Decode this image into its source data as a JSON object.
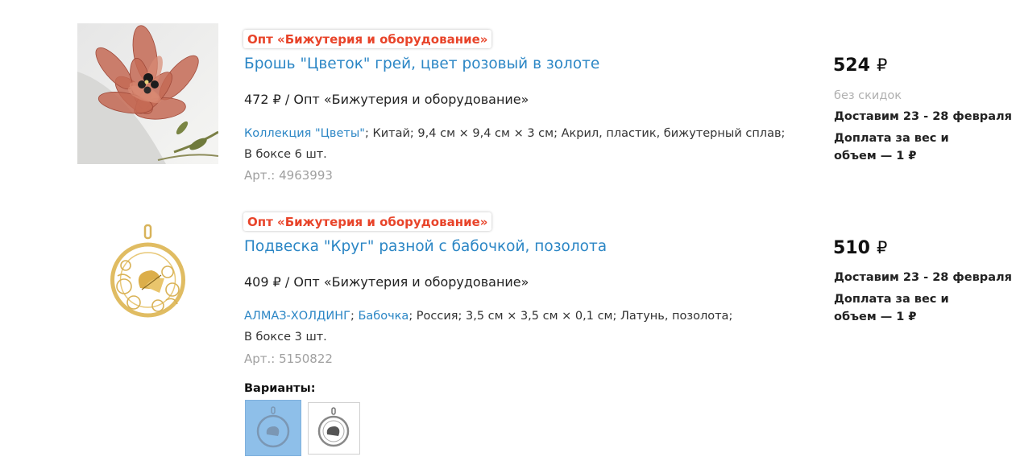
{
  "products": [
    {
      "badge": "Опт «Бижутерия и оборудование»",
      "title": "Брошь \"Цветок\" грей, цвет розовый в золоте",
      "offer": "472 ₽ / Опт «Бижутерия и оборудование»",
      "spec_link1": "Коллекция \"Цветы\"",
      "spec_text": "; Китай; 9,4 см × 9,4 см × 3 см; Акрил, пластик, бижутерный сплав;",
      "spec_line2": "В боксе 6 шт.",
      "article": "Арт.: 4963993",
      "price": "524",
      "currency": "₽",
      "no_discount": "без скидок",
      "delivery": "Доставим 23 - 28 февраля",
      "extra_fee": "Доплата за вес и объем — 1 ₽"
    },
    {
      "badge": "Опт «Бижутерия и оборудование»",
      "title": "Подвеска \"Круг\" разной с бабочкой, позолота",
      "offer": "409 ₽ / Опт «Бижутерия и оборудование»",
      "spec_link1": "АЛМАЗ-ХОЛДИНГ",
      "spec_sep": "; ",
      "spec_link2": "Бабочка",
      "spec_text": "; Россия; 3,5 см × 3,5 см × 0,1 см; Латунь, позолота;",
      "spec_line2": "В боксе 3 шт.",
      "article": "Арт.: 5150822",
      "price": "510",
      "currency": "₽",
      "delivery": "Доставим 23 - 28 февраля",
      "extra_fee": "Доплата за вес и объем — 1 ₽"
    }
  ],
  "variants_label": "Варианты:",
  "colors": {
    "link": "#2b86c5",
    "badge": "#e8442a",
    "variant_selected_bg": "#8ebfe9"
  }
}
